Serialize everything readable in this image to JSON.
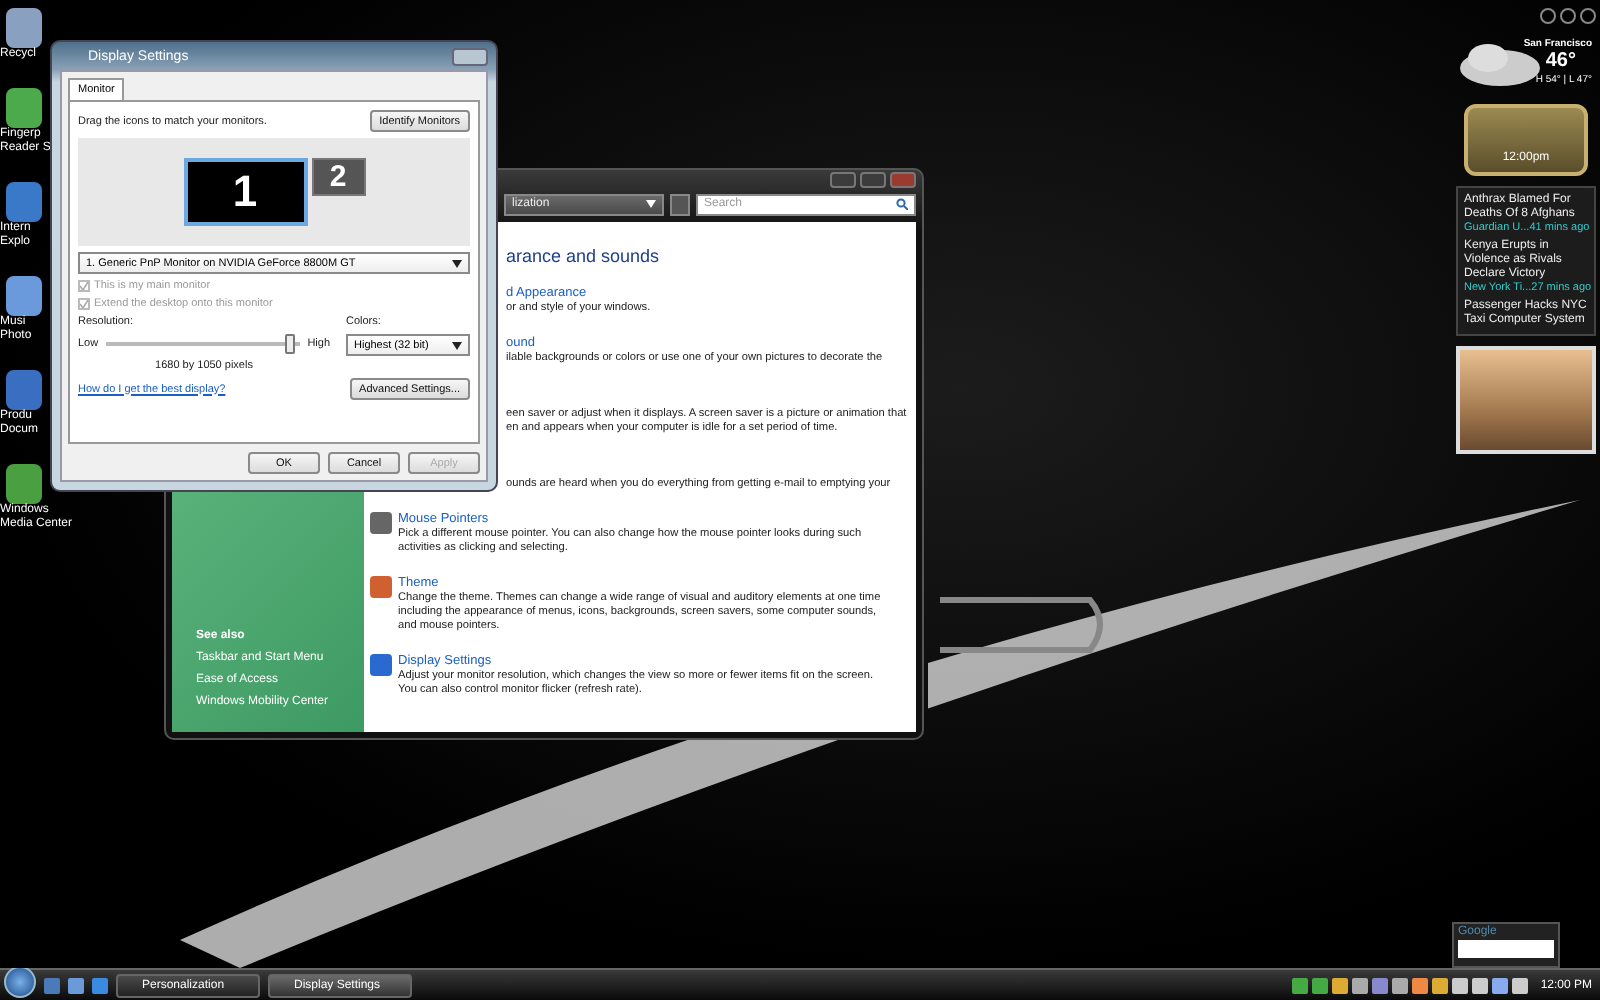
{
  "desktop_icons": [
    {
      "lines": [
        "Recycl"
      ]
    },
    {
      "lines": [
        "Fingerp",
        "Reader S"
      ]
    },
    {
      "lines": [
        "Intern",
        "Explo"
      ]
    },
    {
      "lines": [
        "Musi",
        "Photo"
      ]
    },
    {
      "lines": [
        "Produ",
        "Docum"
      ]
    },
    {
      "lines": [
        "Windows",
        "Media Center"
      ]
    }
  ],
  "personalization": {
    "address": "lization",
    "search": {
      "placeholder": "Search"
    },
    "heading": "arance and sounds",
    "items": [
      {
        "kind": "partial",
        "title": "d Appearance",
        "lines": [
          "or and style of your windows."
        ]
      },
      {
        "kind": "partial",
        "title": "ound",
        "lines": [
          "ilable backgrounds or colors or use one of your own pictures to decorate the"
        ]
      },
      {
        "kind": "partial",
        "lines": [
          "een saver or adjust when it displays. A screen saver is a picture or animation that",
          "en and appears when your computer is idle for a set period of time."
        ]
      },
      {
        "kind": "partial",
        "lines": [
          "ounds are heard when you do everything from getting e-mail to emptying your"
        ]
      },
      {
        "kind": "full",
        "title": "Mouse Pointers",
        "lines": [
          "Pick a different mouse pointer. You can also change how the mouse pointer looks during such",
          "activities as clicking and selecting."
        ]
      },
      {
        "kind": "full",
        "title": "Theme",
        "lines": [
          "Change the theme. Themes can change a wide range of visual and auditory elements at one time",
          "including the appearance of menus, icons, backgrounds, screen savers, some computer sounds,",
          "and mouse pointers."
        ]
      },
      {
        "kind": "full",
        "title": "Display Settings",
        "lines": [
          "Adjust your monitor resolution, which changes the view so more or fewer items fit on the screen.",
          "You can also control monitor flicker (refresh rate)."
        ]
      }
    ],
    "see_also": {
      "title": "See also",
      "links": [
        "Taskbar and Start Menu",
        "Ease of Access",
        "Windows Mobility Center"
      ]
    }
  },
  "display_settings": {
    "title": "Display Settings",
    "tab": "Monitor",
    "instruction": "Drag the icons to match your monitors.",
    "identify_button": "Identify Monitors",
    "monitors": [
      {
        "number": "1",
        "selected": true
      },
      {
        "number": "2",
        "selected": false
      }
    ],
    "monitor_select": "1. Generic PnP Monitor on NVIDIA GeForce 8800M GT",
    "checkboxes": [
      {
        "label": "This is my main monitor",
        "checked": true,
        "disabled": true
      },
      {
        "label": "Extend the desktop onto this monitor",
        "checked": true,
        "disabled": true
      }
    ],
    "resolution": {
      "label": "Resolution:",
      "low": "Low",
      "high": "High",
      "level": 0.98,
      "reading": "1680 by 1050 pixels"
    },
    "colors": {
      "label": "Colors:",
      "value": "Highest (32 bit)"
    },
    "help_link": "How do I get the best display?",
    "advanced_button": "Advanced Settings...",
    "buttons": [
      {
        "label": "OK",
        "disabled": false
      },
      {
        "label": "Cancel",
        "disabled": false
      },
      {
        "label": "Apply",
        "disabled": true
      }
    ]
  },
  "sidebar": {
    "weather": {
      "city": "San Francisco",
      "temperature": "46°",
      "range": "H 54° | L 47°"
    },
    "clock": "12:00pm",
    "news": [
      {
        "headline": "Anthrax Blamed For Deaths Of 8 Afghans",
        "source": "Guardian U...",
        "time": "41 mins ago"
      },
      {
        "headline": "Kenya Erupts in Violence as Rivals Declare Victory",
        "source": "New York Ti...",
        "time": "27 mins ago"
      },
      {
        "headline": "Passenger Hacks NYC Taxi Computer System"
      }
    ]
  },
  "google_gadget": {
    "label": "Google"
  },
  "taskbar": {
    "tasks": [
      {
        "label": "Personalization",
        "selected": false
      },
      {
        "label": "Display Settings",
        "selected": true
      }
    ],
    "clock": "12:00 PM"
  }
}
